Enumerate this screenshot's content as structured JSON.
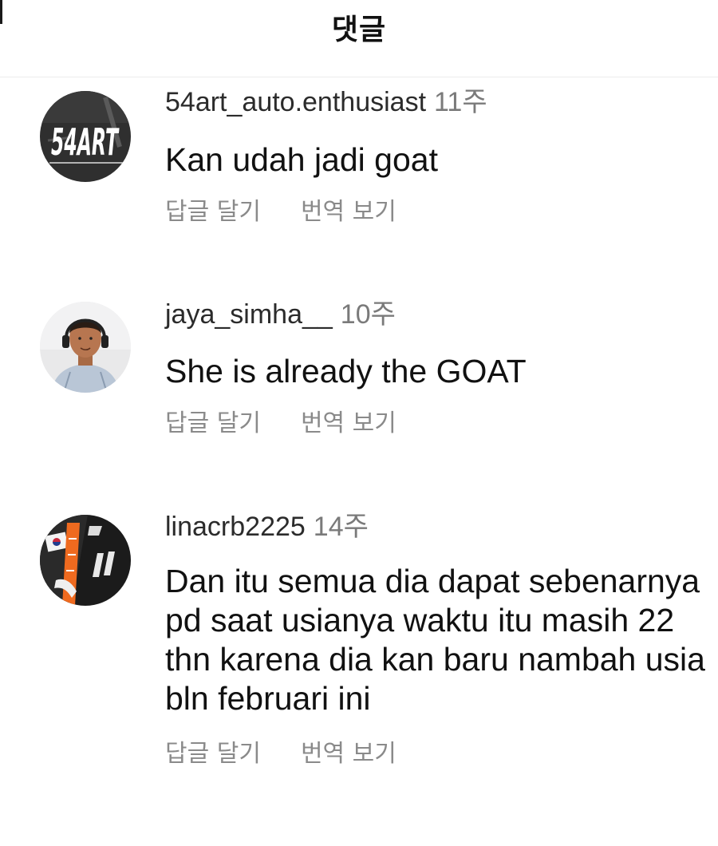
{
  "header": {
    "title": "댓글"
  },
  "comments": [
    {
      "username": "54art_auto.enthusiast",
      "time": "11주",
      "text": "Kan udah jadi goat",
      "reply_label": "답글 달기",
      "translate_label": "번역 보기",
      "avatar_icon": "54art-logo-avatar",
      "avatar_text": "54ART"
    },
    {
      "username": "jaya_simha__",
      "time": "10주",
      "text": "She is already the GOAT",
      "reply_label": "답글 달기",
      "translate_label": "번역 보기",
      "avatar_icon": "person-headphones-avatar"
    },
    {
      "username": "linacrb2225",
      "time": "14주",
      "text": "Dan itu semua dia dapat sebenarnya pd saat usianya waktu itu masih 22 thn karena dia kan baru nambah usia bln februari ini",
      "reply_label": "답글 달기",
      "translate_label": "번역 보기",
      "avatar_icon": "flag-jersey-avatar"
    }
  ],
  "colors": {
    "text_primary": "#111111",
    "text_secondary": "#8a8a8a",
    "divider": "#ececec"
  }
}
